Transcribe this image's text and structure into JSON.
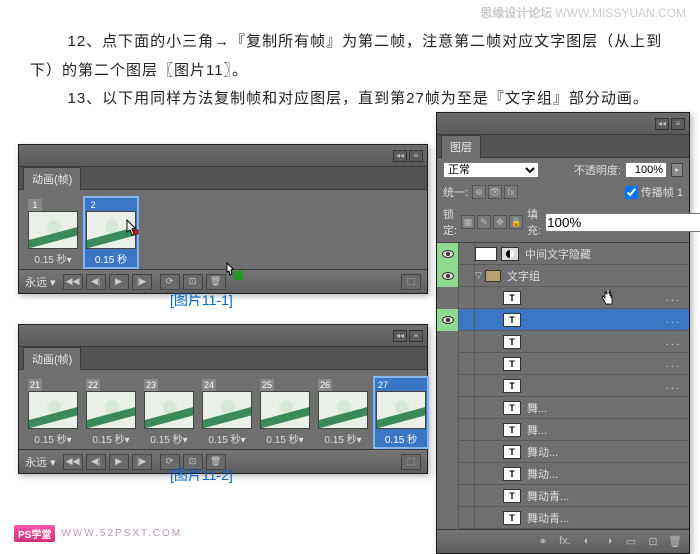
{
  "watermark": {
    "site": "思缘设计论坛",
    "url": "WWW.MISSYUAN.COM"
  },
  "instructions": {
    "line1": "12、点下面的小三角→『复制所有帧』为第二帧，注意第二帧对应文字图层（从上到下）的第二个图层〖图片11〗。",
    "line2": "13、以下用同样方法复制帧和对应图层，直到第27帧为至是『文字组』部分动画。"
  },
  "captions": {
    "c1": "[图片11-1]",
    "c2": "[图片11-2]"
  },
  "anim_panel": {
    "tab": "动画(帧)",
    "loop": "永远",
    "dur": "0.15 秒▾",
    "frames1": [
      {
        "n": "1",
        "dur": "0.15 秒▾",
        "sel": false
      },
      {
        "n": "2",
        "dur": "0.15 秒",
        "sel": true
      }
    ],
    "frames2": [
      {
        "n": "21",
        "dur": "0.15 秒▾"
      },
      {
        "n": "22",
        "dur": "0.15 秒▾"
      },
      {
        "n": "23",
        "dur": "0.15 秒▾"
      },
      {
        "n": "24",
        "dur": "0.15 秒▾"
      },
      {
        "n": "25",
        "dur": "0.15 秒▾"
      },
      {
        "n": "26",
        "dur": "0.15 秒▾"
      },
      {
        "n": "27",
        "dur": "0.15 秒",
        "sel": true
      }
    ]
  },
  "layers_panel": {
    "tab": "图层",
    "blend": "正常",
    "opacity_label": "不透明度:",
    "opacity": "100%",
    "unify": "统一:",
    "propagate": "传播帧 1",
    "lock_label": "锁定:",
    "fill_label": "填充:",
    "fill": "100%",
    "rows": [
      {
        "eye": true,
        "type": "adj",
        "name": "中间文字隐藏",
        "indent": 0
      },
      {
        "eye": true,
        "type": "folder",
        "name": "文字组",
        "indent": 0,
        "open": true
      },
      {
        "eye": false,
        "type": "T",
        "name": "",
        "indent": 2,
        "dots": true
      },
      {
        "eye": true,
        "type": "T",
        "name": "",
        "indent": 2,
        "dots": true,
        "sel": true
      },
      {
        "eye": false,
        "type": "T",
        "name": "",
        "indent": 2,
        "dots": true
      },
      {
        "eye": false,
        "type": "T",
        "name": "",
        "indent": 2,
        "dots": true
      },
      {
        "eye": false,
        "type": "T",
        "name": "",
        "indent": 2,
        "dots": true
      },
      {
        "eye": false,
        "type": "T",
        "name": "舞...",
        "indent": 2
      },
      {
        "eye": false,
        "type": "T",
        "name": "舞...",
        "indent": 2
      },
      {
        "eye": false,
        "type": "T",
        "name": "舞动...",
        "indent": 2
      },
      {
        "eye": false,
        "type": "T",
        "name": "舞动...",
        "indent": 2
      },
      {
        "eye": false,
        "type": "T",
        "name": "舞动青...",
        "indent": 2
      },
      {
        "eye": false,
        "type": "T",
        "name": "舞动青...",
        "indent": 2
      }
    ]
  },
  "footer": {
    "badge": "PS学堂",
    "url": "WWW.52PSXT.COM"
  }
}
